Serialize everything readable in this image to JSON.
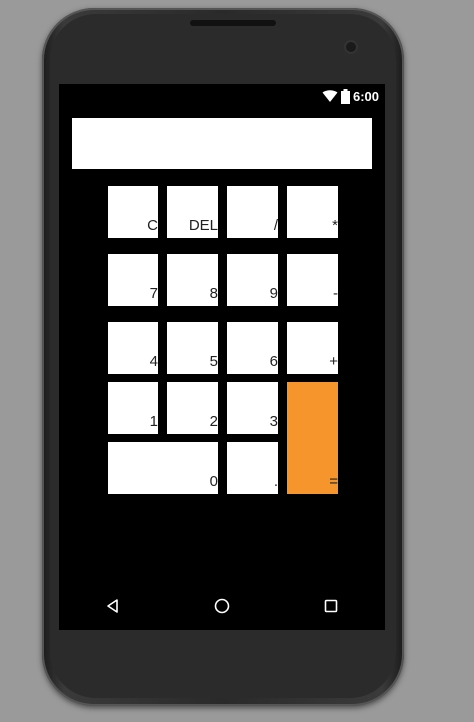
{
  "status_bar": {
    "time": "6:00",
    "icons": [
      "wifi-icon",
      "battery-icon"
    ]
  },
  "display": {
    "value": "",
    "placeholder": ""
  },
  "keys": {
    "clear": "C",
    "delete": "DEL",
    "divide": "/",
    "multiply": "*",
    "seven": "7",
    "eight": "8",
    "nine": "9",
    "minus": "-",
    "four": "4",
    "five": "5",
    "six": "6",
    "plus": "+",
    "one": "1",
    "two": "2",
    "three": "3",
    "zero": "0",
    "dot": ".",
    "equals": "="
  },
  "nav_bar": {
    "icons": [
      "back-icon",
      "home-icon",
      "recents-icon"
    ]
  },
  "colors": {
    "accent": "#f7952d",
    "screen_background": "#000000",
    "key_background": "#ffffff"
  }
}
